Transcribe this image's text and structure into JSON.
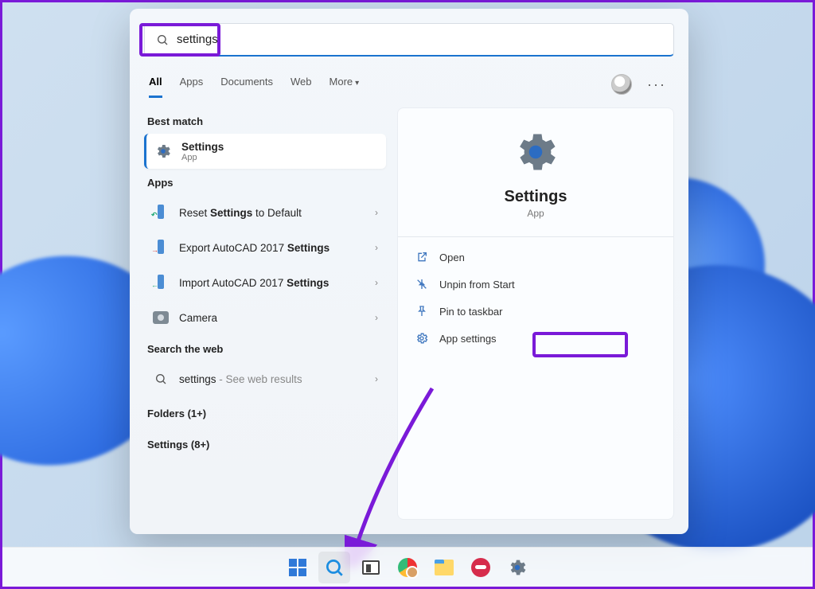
{
  "search": {
    "query": "settings"
  },
  "tabs": {
    "all": "All",
    "apps": "Apps",
    "documents": "Documents",
    "web": "Web",
    "more": "More"
  },
  "left": {
    "best_match_label": "Best match",
    "best_match": {
      "title": "Settings",
      "subtitle": "App"
    },
    "apps_label": "Apps",
    "apps": [
      {
        "pre": "Reset ",
        "bold": "Settings",
        "post": " to Default",
        "arrow": "↶"
      },
      {
        "pre": "Export AutoCAD 2017 ",
        "bold": "Settings",
        "post": "",
        "arrow": "→"
      },
      {
        "pre": "Import AutoCAD 2017 ",
        "bold": "Settings",
        "post": "",
        "arrow": "←"
      },
      {
        "pre": "Camera",
        "bold": "",
        "post": "",
        "arrow": ""
      }
    ],
    "web_label": "Search the web",
    "web_item": {
      "query": "settings",
      "suffix": " - See web results"
    },
    "folders_label": "Folders (1+)",
    "settings_label": "Settings (8+)"
  },
  "right": {
    "app_name": "Settings",
    "app_type": "App",
    "actions": {
      "open": "Open",
      "unpin": "Unpin from Start",
      "pin": "Pin to taskbar",
      "appsettings": "App settings"
    }
  },
  "taskbar": {
    "start": "start",
    "search": "search",
    "taskview": "task-view",
    "chrome": "chrome",
    "explorer": "file-explorer",
    "lips": "app-lips",
    "settings": "settings"
  }
}
